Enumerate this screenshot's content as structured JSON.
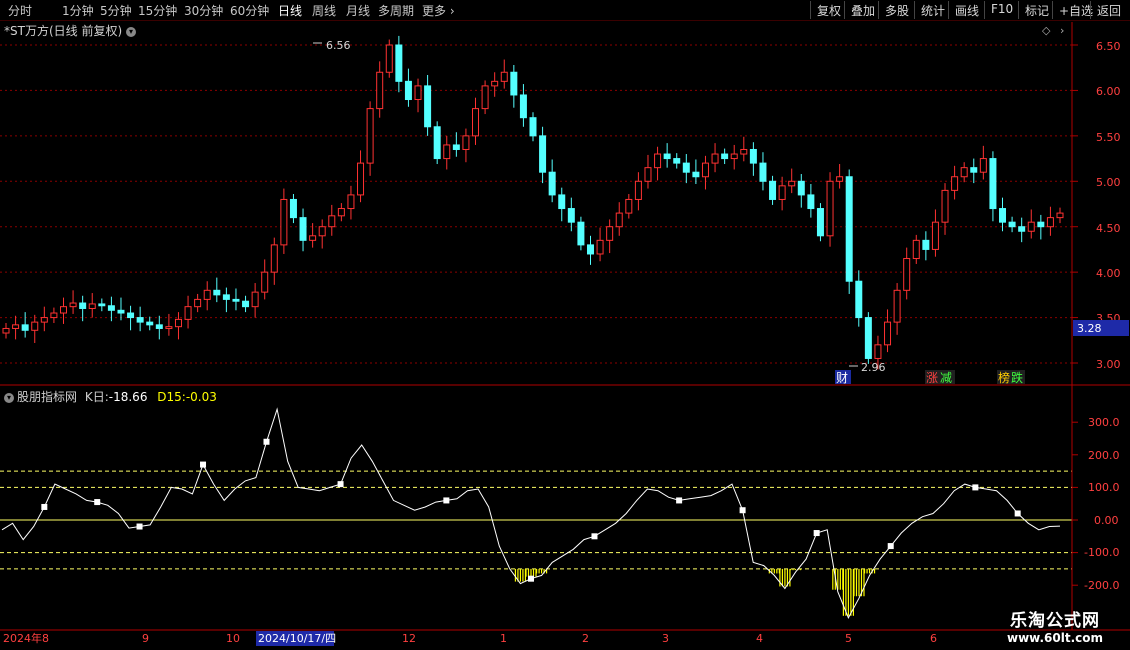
{
  "toolbar": {
    "periods": [
      "分时",
      "1分钟",
      "5分钟",
      "15分钟",
      "30分钟",
      "60分钟",
      "日线",
      "周线",
      "月线",
      "多周期",
      "更多"
    ],
    "active": "日线",
    "more_arrow": "›",
    "right_buttons": [
      "复权",
      "叠加",
      "多股",
      "统计",
      "画线",
      "F10",
      "标记",
      "+自选",
      "返回"
    ]
  },
  "main_chart": {
    "title": "*ST万方(日线 前复权)",
    "title_icon": "chevron-down-icon",
    "y_ticks": [
      "6.50",
      "6.00",
      "5.50",
      "5.00",
      "4.50",
      "4.00",
      "3.50",
      "3.00"
    ],
    "price_tag": "3.28",
    "high_label": "6.56",
    "low_label": "2.96",
    "markers": [
      "财",
      "涨",
      "减",
      "榜",
      "跌"
    ],
    "colors": {
      "up": "#ff3232",
      "down": "#54ffff",
      "grid": "#8b0000",
      "axis": "#b00000",
      "price_tag_bg": "#1e2aa8"
    }
  },
  "indicator": {
    "name": "股朋指标网",
    "k_label": "K日:",
    "k_value": "-18.66",
    "d_label": "D15:",
    "d_value": "-0.03",
    "y_ticks": [
      "300.0",
      "200.0",
      "100.0",
      "0.00",
      "-100.0",
      "-200.0"
    ],
    "levels": [
      150,
      100,
      0,
      -100,
      -150
    ],
    "colors": {
      "line": "#ffffff",
      "level": "#ffff66",
      "bars": "#ffff00",
      "k_value": "#ffffff",
      "d_value": "#ffff00"
    }
  },
  "x_axis": {
    "labels": [
      "2024年8",
      "9",
      "10",
      "2024/10/17/四",
      "12",
      "1",
      "2",
      "3",
      "4",
      "5",
      "6"
    ],
    "highlighted": "2024/10/17/四"
  },
  "watermark": {
    "line1": "乐淘公式网",
    "line2": "www.60lt.com"
  },
  "chart_data": {
    "type": "line",
    "price_axis": {
      "ylim": [
        2.9,
        6.6
      ],
      "ticks": [
        6.5,
        6.0,
        5.5,
        5.0,
        4.5,
        4.0,
        3.5,
        3.0
      ]
    },
    "price_close": [
      3.38,
      3.42,
      3.36,
      3.45,
      3.5,
      3.55,
      3.62,
      3.66,
      3.6,
      3.65,
      3.63,
      3.58,
      3.55,
      3.5,
      3.45,
      3.42,
      3.38,
      3.4,
      3.48,
      3.62,
      3.7,
      3.8,
      3.75,
      3.7,
      3.68,
      3.62,
      3.78,
      4.0,
      4.3,
      4.8,
      4.6,
      4.35,
      4.4,
      4.5,
      4.62,
      4.7,
      4.85,
      5.2,
      5.8,
      6.2,
      6.5,
      6.1,
      5.9,
      6.05,
      5.6,
      5.25,
      5.4,
      5.35,
      5.5,
      5.8,
      6.05,
      6.1,
      6.2,
      5.95,
      5.7,
      5.5,
      5.1,
      4.85,
      4.7,
      4.55,
      4.3,
      4.2,
      4.35,
      4.5,
      4.65,
      4.8,
      5.0,
      5.15,
      5.3,
      5.25,
      5.2,
      5.1,
      5.05,
      5.2,
      5.3,
      5.25,
      5.3,
      5.35,
      5.2,
      5.0,
      4.8,
      4.95,
      5.0,
      4.85,
      4.7,
      4.4,
      5.0,
      5.05,
      3.9,
      3.5,
      3.05,
      3.2,
      3.45,
      3.8,
      4.15,
      4.35,
      4.25,
      4.55,
      4.9,
      5.05,
      5.15,
      5.1,
      5.25,
      4.7,
      4.55,
      4.5,
      4.45,
      4.55,
      4.5,
      4.6,
      4.65
    ],
    "indicator_axis": {
      "ylim": [
        -320,
        400
      ],
      "ticks": [
        300,
        200,
        100,
        0,
        -100,
        -200
      ]
    },
    "indicator_k": [
      -30,
      -10,
      -60,
      -20,
      40,
      110,
      95,
      80,
      60,
      55,
      45,
      20,
      -25,
      -20,
      -15,
      40,
      100,
      95,
      80,
      170,
      110,
      60,
      95,
      120,
      130,
      240,
      340,
      180,
      100,
      95,
      90,
      100,
      110,
      190,
      230,
      180,
      120,
      60,
      45,
      30,
      40,
      55,
      60,
      65,
      90,
      95,
      40,
      -80,
      -150,
      -195,
      -180,
      -170,
      -130,
      -110,
      -90,
      -60,
      -50,
      -30,
      -10,
      20,
      60,
      95,
      90,
      70,
      60,
      65,
      70,
      75,
      90,
      110,
      30,
      -130,
      -140,
      -170,
      -210,
      -160,
      -120,
      -40,
      -30,
      -220,
      -300,
      -240,
      -170,
      -120,
      -80,
      -40,
      -10,
      10,
      20,
      50,
      90,
      110,
      100,
      95,
      90,
      60,
      20,
      -10,
      -30,
      -20,
      -18.66
    ],
    "indicator_d": [
      -0.03
    ]
  }
}
